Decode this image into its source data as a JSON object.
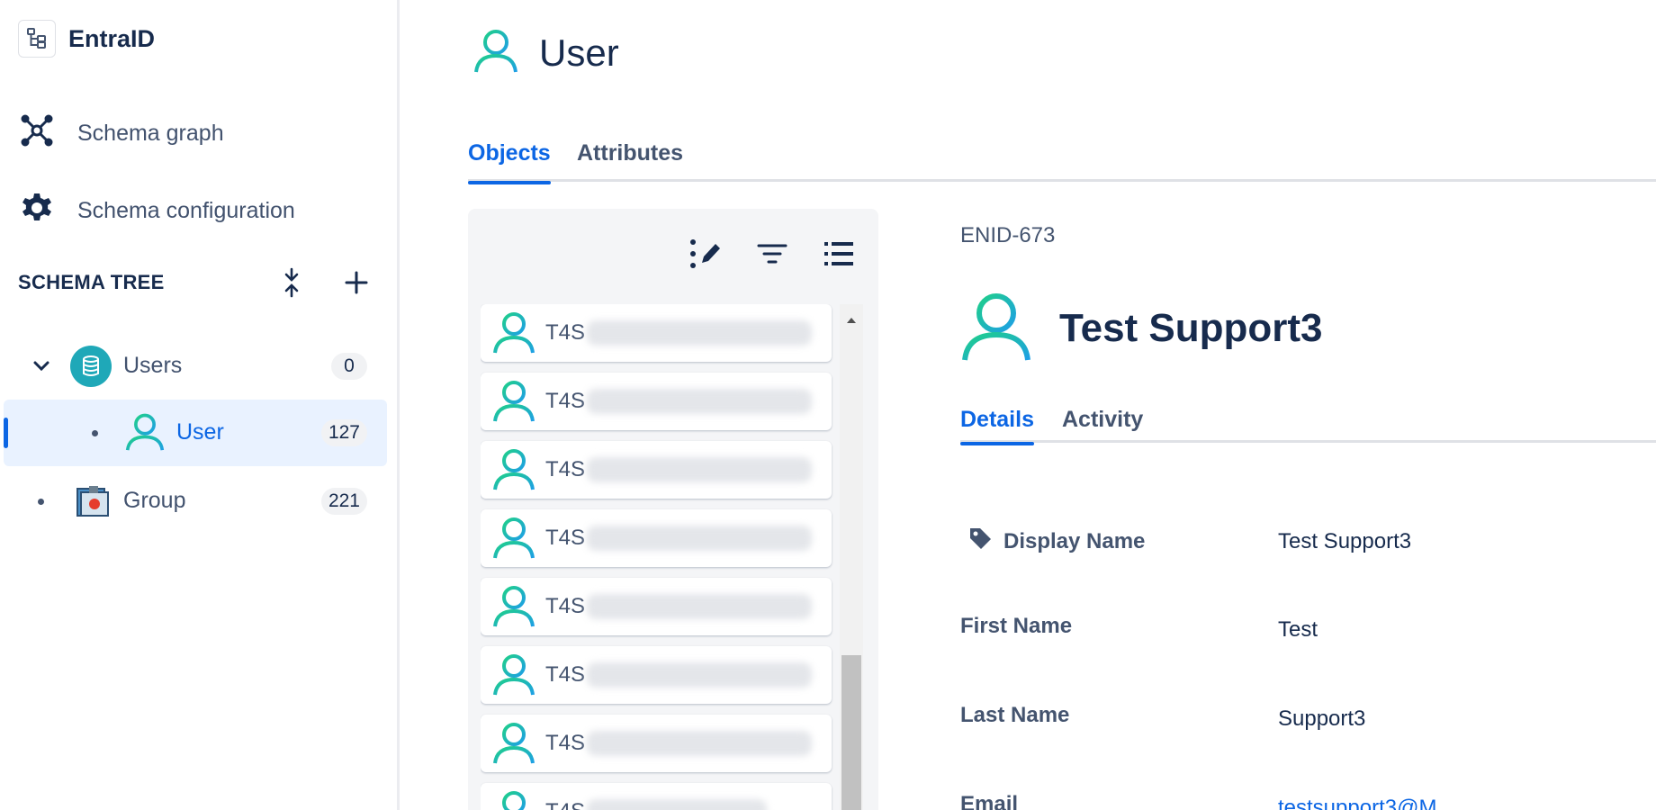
{
  "sidebar": {
    "space_title": "EntraID",
    "nav": {
      "schema_graph": "Schema graph",
      "schema_configuration": "Schema configuration"
    },
    "tree_header": "SCHEMA TREE",
    "tree": [
      {
        "label": "Users",
        "count": "0"
      },
      {
        "label": "User",
        "count": "127"
      },
      {
        "label": "Group",
        "count": "221"
      }
    ]
  },
  "main": {
    "title": "User",
    "tabs": [
      "Objects",
      "Attributes"
    ],
    "list_items": [
      "T4S",
      "T4S",
      "T4S",
      "T4S",
      "T4S",
      "T4S",
      "T4S",
      "T4S"
    ],
    "detail": {
      "object_key": "ENID-673",
      "title": "Test Support3",
      "tabs": [
        "Details",
        "Activity"
      ],
      "attributes": [
        {
          "label": "Display Name",
          "value": "Test Support3"
        },
        {
          "label": "First Name",
          "value": "Test"
        },
        {
          "label": "Last Name",
          "value": "Support3"
        },
        {
          "label": "Email",
          "value": "testsupport3@M..."
        }
      ]
    }
  },
  "colors": {
    "accent": "#0c66e4",
    "user_icon_start": "#1fcf8a",
    "user_icon_end": "#1e9fe6",
    "selected_bg": "#e9f2ff"
  },
  "icons": [
    "tree-structure-icon",
    "schema-graph-icon",
    "gear-icon",
    "collapse-icon",
    "plus-icon",
    "chevron-down-icon",
    "database-icon",
    "user-icon",
    "group-icon",
    "edit-list-icon",
    "filter-icon",
    "list-icon",
    "tag-icon",
    "scroll-up-icon"
  ]
}
